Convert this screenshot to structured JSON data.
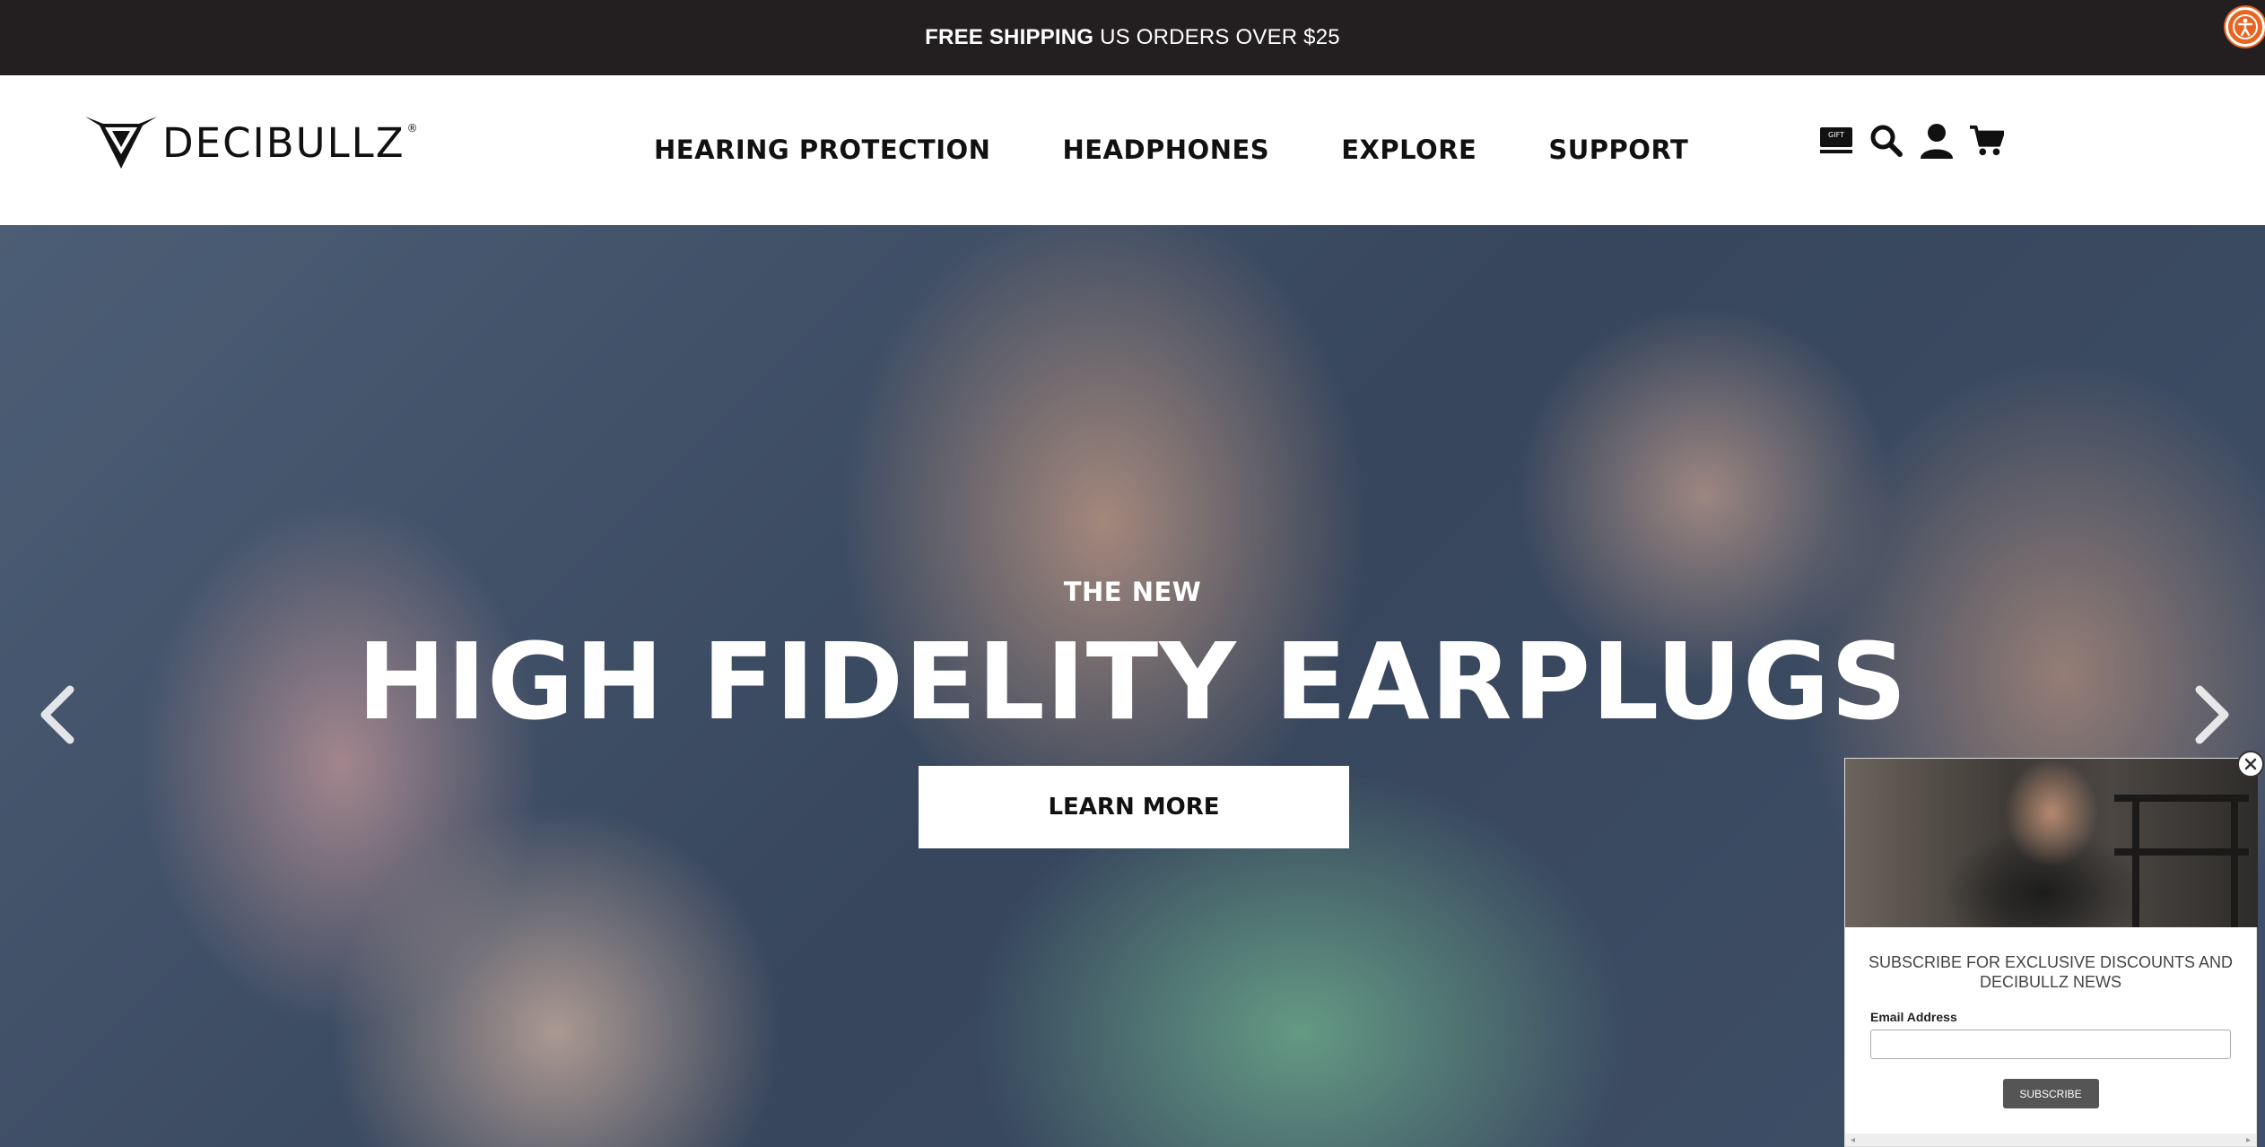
{
  "announcement": {
    "strong": "FREE SHIPPING",
    "rest": "US ORDERS OVER $25"
  },
  "accessibility": {
    "icon": "accessibility-icon"
  },
  "header": {
    "logo_text": "DECIBULLZ",
    "logo_tm": "®",
    "nav": [
      {
        "label": "HEARING PROTECTION"
      },
      {
        "label": "HEADPHONES"
      },
      {
        "label": "EXPLORE"
      },
      {
        "label": "SUPPORT"
      }
    ],
    "icons": {
      "gift_card": "gift-card-icon",
      "gift_label": "GIFT",
      "search": "search-icon",
      "account": "account-icon",
      "cart": "cart-icon"
    }
  },
  "hero": {
    "eyebrow": "THE NEW",
    "title": "HIGH FIDELITY EARPLUGS",
    "cta_label": "LEARN MORE",
    "prev_icon": "chevron-left-icon",
    "next_icon": "chevron-right-icon"
  },
  "popup": {
    "headline": "SUBSCRIBE FOR EXCLUSIVE DISCOUNTS AND DECIBULLZ NEWS",
    "email_label": "Email Address",
    "email_value": "",
    "submit_label": "SUBSCRIBE",
    "close_icon": "close-icon"
  },
  "colors": {
    "announcement_bg": "#231f20",
    "accessibility_bg": "#e86420",
    "submit_bg": "#555555"
  }
}
